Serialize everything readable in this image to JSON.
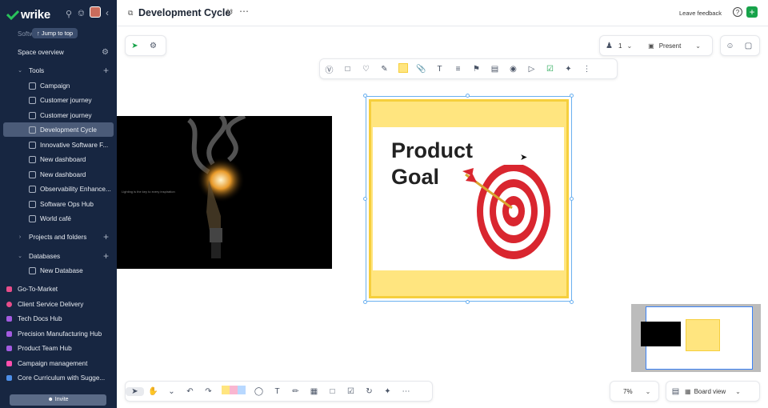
{
  "sidebar": {
    "brand": "wrike",
    "jump_label": "Jump to top",
    "space_partial": "Softw",
    "space_overview": "Space overview",
    "tools_label": "Tools",
    "tools": [
      "Campaign",
      "Customer journey",
      "Customer journey",
      "Development Cycle",
      "Innovative Software F...",
      "New dashboard",
      "New dashboard",
      "Observability Enhance...",
      "Software Ops Hub",
      "World café"
    ],
    "projects_label": "Projects and folders",
    "databases_label": "Databases",
    "new_database": "New Database",
    "spaces": [
      {
        "label": "Go-To-Market",
        "color": "#e84d8a"
      },
      {
        "label": "Client Service Delivery",
        "color": "#e84d8a"
      },
      {
        "label": "Tech Docs Hub",
        "color": "#a35be0"
      },
      {
        "label": "Precision Manufacturing Hub",
        "color": "#a35be0"
      },
      {
        "label": "Product Team Hub",
        "color": "#a35be0"
      },
      {
        "label": "Campaign management",
        "color": "#ff4fae"
      },
      {
        "label": "Core Curriculum with Sugge...",
        "color": "#4d8fe8"
      }
    ],
    "invite": "Invite"
  },
  "header": {
    "title": "Development Cycle",
    "feedback": "Leave feedback"
  },
  "toolbar": {
    "collaborators": "1",
    "present": "Present"
  },
  "sticky": {
    "line1": "Product",
    "line2": "Goal"
  },
  "photo_caption": "Lighting is the key to every inspiration",
  "bottom": {
    "zoom": "7%",
    "view": "Board view"
  },
  "colors": {
    "sidebar_bg": "#172641",
    "sticky_fill": "#ffe57f",
    "sticky_border": "#f6cf3d",
    "accent": "#17a34a",
    "selection": "#6ab0f0"
  }
}
